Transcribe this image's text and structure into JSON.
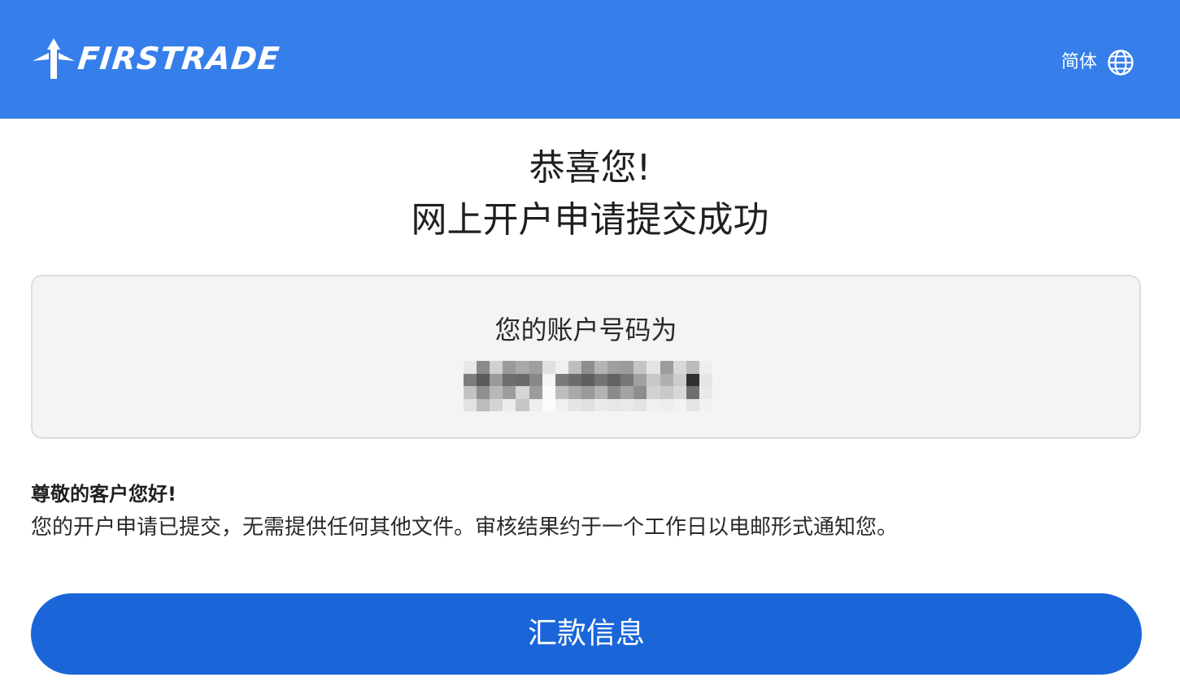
{
  "header": {
    "brand_name": "FIRSTRADE",
    "brand_icon": "firstrade-logo-icon",
    "language_label": "简体",
    "language_icon": "globe-icon",
    "background_color": "#367fea"
  },
  "title": {
    "line1": "恭喜您!",
    "line2": "网上开户申请提交成功"
  },
  "account": {
    "label": "您的账户号码为",
    "number_state": "pixelated (redacted)"
  },
  "notice": {
    "greeting": "尊敬的客户您好!",
    "message": "您的开户申请已提交，无需提供任何其他文件。审核结果约于一个工作日以电邮形式通知您。"
  },
  "actions": {
    "primary_button_label": "汇款信息",
    "primary_button_color": "#1a66d9"
  }
}
